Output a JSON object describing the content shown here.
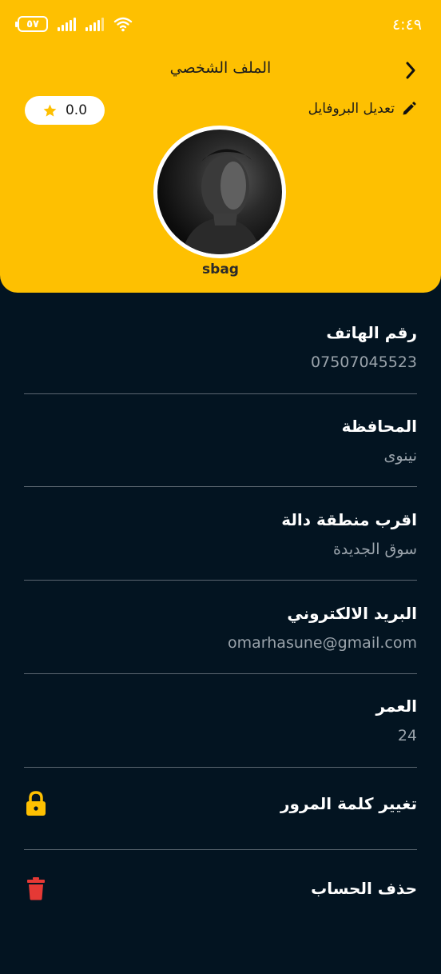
{
  "status_bar": {
    "time": "٤:٤٩",
    "battery": "٥٧"
  },
  "header": {
    "title": "الملف الشخصي",
    "edit_label": "تعديل البروفايل",
    "rating": "0.0",
    "username": "sbag"
  },
  "fields": [
    {
      "label": "رقم الهاتف",
      "value": "07507045523"
    },
    {
      "label": "المحافظة",
      "value": "نينوى"
    },
    {
      "label": "اقرب منطقة دالة",
      "value": "سوق الجديدة"
    },
    {
      "label": "البريد الالكتروني",
      "value": "omarhasune@gmail.com"
    },
    {
      "label": "العمر",
      "value": "24"
    }
  ],
  "actions": {
    "change_password": "تغيير كلمة المرور",
    "delete_account": "حذف الحساب"
  },
  "colors": {
    "brand_yellow": "#FEC001",
    "background": "#031421",
    "delete_red": "#E53935"
  }
}
